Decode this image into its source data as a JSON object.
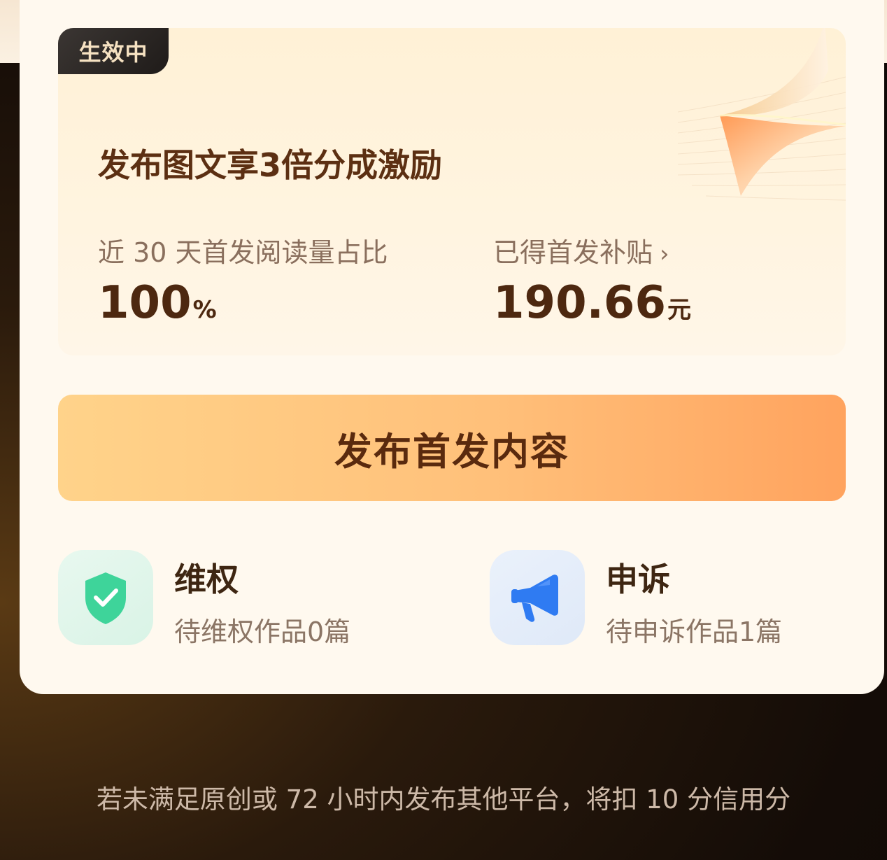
{
  "card": {
    "status_tag": "生效中",
    "title": "发布图文享3倍分成激励",
    "stats": [
      {
        "label": "近 30 天首发阅读量占比",
        "value": "100",
        "unit": "%"
      },
      {
        "label": "已得首发补贴",
        "value": "190.66",
        "unit": "元",
        "chevron": "›"
      }
    ]
  },
  "publish_button": {
    "label": "发布首发内容"
  },
  "entries": [
    {
      "title": "维权",
      "subtitle": "待维权作品0篇",
      "icon": "shield-check-icon",
      "color": "#3ed49a"
    },
    {
      "title": "申诉",
      "subtitle": "待申诉作品1篇",
      "icon": "megaphone-icon",
      "color": "#2f7bf2"
    }
  ],
  "footer_note": "若未满足原创或 72 小时内发布其他平台，将扣 10 分信用分",
  "colors": {
    "accent": "#ffa35e",
    "title_brown": "#5c2f12",
    "card_bg": "#fff9ef"
  }
}
